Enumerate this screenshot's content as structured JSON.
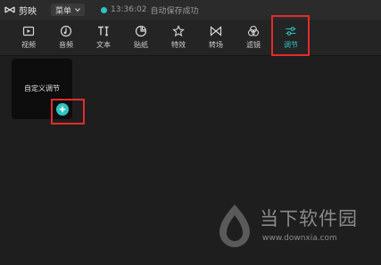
{
  "titlebar": {
    "app_name": "剪映",
    "menu_label": "菜单",
    "save_time": "13:36:02",
    "save_status": "自动保存成功"
  },
  "toolbar": {
    "items": [
      {
        "label": "视频",
        "icon": "video-icon"
      },
      {
        "label": "音频",
        "icon": "audio-icon"
      },
      {
        "label": "文本",
        "icon": "text-icon"
      },
      {
        "label": "贴纸",
        "icon": "sticker-icon"
      },
      {
        "label": "特效",
        "icon": "effects-icon"
      },
      {
        "label": "转场",
        "icon": "transition-icon"
      },
      {
        "label": "滤镜",
        "icon": "filter-icon"
      },
      {
        "label": "调节",
        "icon": "adjust-icon",
        "active": true
      }
    ]
  },
  "panel": {
    "card_label": "自定义调节"
  },
  "watermark": {
    "text": "当下软件园",
    "url": "www.downxia.com"
  },
  "colors": {
    "accent": "#2ec4c4",
    "highlight": "#e32b2b",
    "background": "#1e1e1e"
  }
}
